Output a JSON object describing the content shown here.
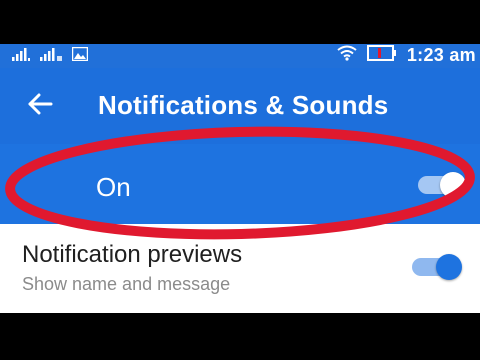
{
  "status_bar": {
    "time": "1:23 am",
    "icons": [
      "signal-bars-icon",
      "signal-bars-2-icon",
      "image-notification-icon",
      "wifi-icon",
      "battery-icon"
    ]
  },
  "app_bar": {
    "back_icon": "arrow-left-icon",
    "title": "Notifications & Sounds"
  },
  "master_toggle": {
    "label": "On",
    "checked": true
  },
  "preferences": [
    {
      "title": "Notification previews",
      "summary": "Show name and message",
      "checked": true
    }
  ],
  "colors": {
    "primary": "#1e73e0",
    "annotation_red": "#e0192f"
  }
}
